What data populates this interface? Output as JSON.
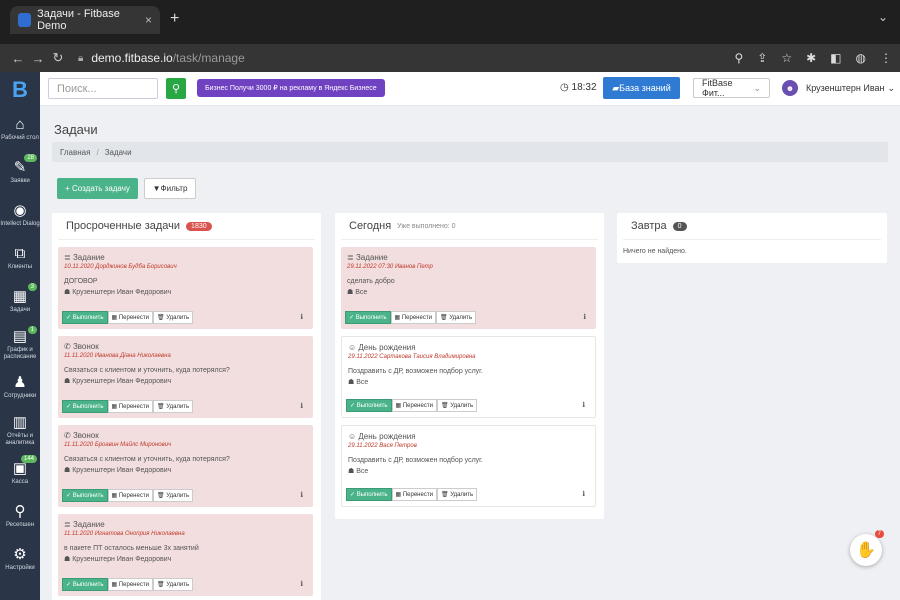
{
  "browser": {
    "tab_title": "Задачи - Fitbase Demo",
    "tab_close": "×",
    "new_tab": "+",
    "url_host": "demo.fitbase.io",
    "url_path": "/task/manage"
  },
  "sidebar": {
    "items": [
      {
        "icon": "home-icon",
        "glyph": "⌂",
        "label": "Рабочий стол"
      },
      {
        "icon": "pencil-icon",
        "glyph": "✎",
        "label": "Заявки",
        "badge": "28"
      },
      {
        "icon": "intellect-icon",
        "glyph": "◉",
        "label": "Intellect Dialog"
      },
      {
        "icon": "clients-icon",
        "glyph": "⧉",
        "label": "Клиенты"
      },
      {
        "icon": "tasks-icon",
        "glyph": "▦",
        "label": "Задачи",
        "badge": "3"
      },
      {
        "icon": "schedule-icon",
        "glyph": "▤",
        "label": "График и расписание",
        "badge": "1"
      },
      {
        "icon": "staff-icon",
        "glyph": "♟",
        "label": "Сотрудники"
      },
      {
        "icon": "analytics-icon",
        "glyph": "▥",
        "label": "Отчёты и аналитика"
      },
      {
        "icon": "cash-icon",
        "glyph": "▣",
        "label": "Касса",
        "badge": "144"
      },
      {
        "icon": "reception-icon",
        "glyph": "⚲",
        "label": "Ресепшен"
      },
      {
        "icon": "settings-icon",
        "glyph": "⚙",
        "label": "Настройки"
      }
    ]
  },
  "topbar": {
    "search_placeholder": "Поиск...",
    "promo": "Бизнес  Получи 3000 ₽ на рекламу в Яндекс Бизнесе",
    "time": "18:32",
    "kb": "База знаний",
    "club": "FitBase Фит...",
    "user": "Крузенштерн Иван"
  },
  "page": {
    "title": "Задачи",
    "crumb_home": "Главная",
    "crumb_sep": "/",
    "crumb_current": "Задачи",
    "create": "+ Создать задачу",
    "filter": "Фильтр"
  },
  "columns": {
    "overdue": {
      "title": "Просроченные задачи",
      "count": "1830"
    },
    "today": {
      "title": "Сегодня",
      "done": "Уже выполнено: 0"
    },
    "tomorrow": {
      "title": "Завтра",
      "count": "0",
      "empty": "Ничего не найдено."
    }
  },
  "actions": {
    "do": "Выполнить",
    "move": "Перенести",
    "del": "Удалить"
  },
  "overdue_tasks": [
    {
      "type": "Задание",
      "date": "10.11.2020",
      "person": "Дорджинов Будба Борисович",
      "desc": "ДОГОВОР",
      "owner": "Крузенштерн Иван Федорович"
    },
    {
      "type": "Звонок",
      "date": "11.11.2020",
      "person": "Иванова Діана Николаевна",
      "desc": "Связаться с клиентом и уточнить, куда потерялся?",
      "owner": "Крузенштерн Иван Федорович"
    },
    {
      "type": "Звонок",
      "date": "11.11.2020",
      "person": "Броавин Майлс Миронович",
      "desc": "Связаться с клиентом и уточнить, куда потерялся?",
      "owner": "Крузенштерн Иван Федорович"
    },
    {
      "type": "Задание",
      "date": "11.11.2020",
      "person": "Игнатова Оноприя Николаевна",
      "desc": "в пакете ПТ осталось меньше 3х занятий",
      "owner": "Крузенштерн Иван Федорович"
    }
  ],
  "today_tasks": [
    {
      "type": "Задание",
      "date": "29.11.2022 07:30",
      "person": "Иванов Петр",
      "desc": "сделать добро",
      "owner": "Все"
    },
    {
      "type": "День рождения",
      "date": "29.11.2022",
      "person": "Сартакова Таисия Владимировна",
      "desc": "Поздравить с ДР, возможен подбор услуг.",
      "owner": "Все"
    },
    {
      "type": "День рождения",
      "date": "29.11.2022",
      "person": "Вася Петров",
      "desc": "Поздравить с ДР, возможен подбор услуг.",
      "owner": "Все"
    }
  ],
  "help_badge": "7"
}
